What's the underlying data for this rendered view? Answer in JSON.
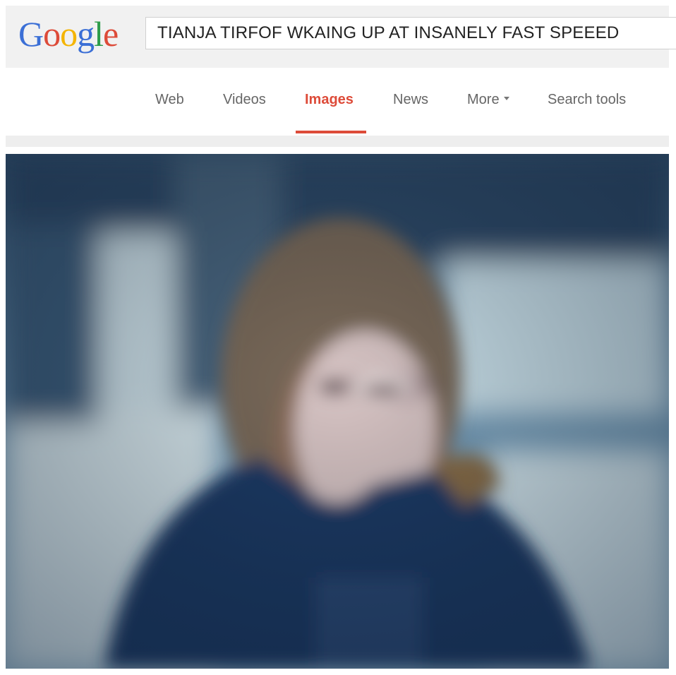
{
  "header": {
    "logo": {
      "letters": [
        "G",
        "o",
        "o",
        "g",
        "l",
        "e"
      ],
      "colors": [
        "#3b6fd6",
        "#dd4b39",
        "#f4b400",
        "#3b6fd6",
        "#2e9d4b",
        "#dd4b39"
      ]
    },
    "search": {
      "query": "TIANJA TIRFOF WKAING UP AT INSANELY FAST SPEEED"
    }
  },
  "tabs": [
    {
      "label": "Web",
      "active": false
    },
    {
      "label": "Videos",
      "active": false
    },
    {
      "label": "Images",
      "active": true
    },
    {
      "label": "News",
      "active": false
    },
    {
      "label": "More",
      "active": false,
      "has_caret": true
    },
    {
      "label": "Search tools",
      "active": false
    }
  ],
  "accent_color": "#dd4b39",
  "photo": {
    "icon": "blurred-photo"
  }
}
